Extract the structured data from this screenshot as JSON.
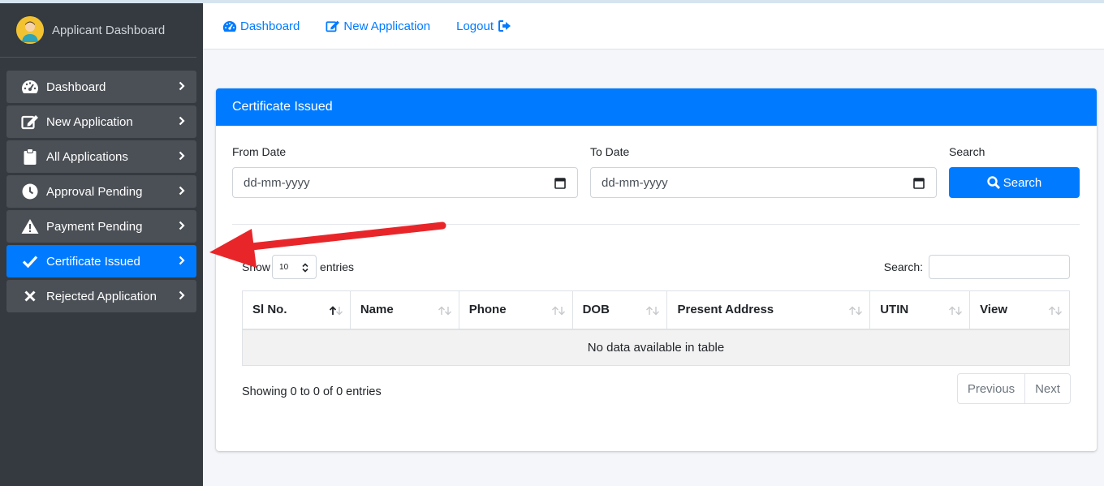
{
  "sidebar": {
    "brand": "Applicant Dashboard",
    "items": [
      {
        "label": "Dashboard",
        "icon": "gauge-icon",
        "active": false
      },
      {
        "label": "New Application",
        "icon": "edit-icon",
        "active": false
      },
      {
        "label": "All Applications",
        "icon": "clipboard-icon",
        "active": false
      },
      {
        "label": "Approval Pending",
        "icon": "clock-icon",
        "active": false
      },
      {
        "label": "Payment Pending",
        "icon": "warning-icon",
        "active": false
      },
      {
        "label": "Certificate Issued",
        "icon": "check-icon",
        "active": true
      },
      {
        "label": "Rejected Application",
        "icon": "times-icon",
        "active": false
      }
    ]
  },
  "topbar": {
    "dashboard": "Dashboard",
    "new_application": "New Application",
    "logout": "Logout"
  },
  "card": {
    "title": "Certificate Issued",
    "from_label": "From Date",
    "to_label": "To Date",
    "search_label": "Search",
    "date_placeholder": "dd-mm-yyyy",
    "search_button": "Search"
  },
  "table": {
    "show": "Show",
    "length": "10",
    "entries": "entries",
    "search_label": "Search:",
    "columns": [
      "Sl No.",
      "Name",
      "Phone",
      "DOB",
      "Present Address",
      "UTIN",
      "View"
    ],
    "empty": "No data available in table",
    "info": "Showing 0 to 0 of 0 entries",
    "previous": "Previous",
    "next": "Next"
  },
  "colors": {
    "primary": "#007bff",
    "sidebar": "#343a40",
    "annotation": "#e8262a"
  }
}
